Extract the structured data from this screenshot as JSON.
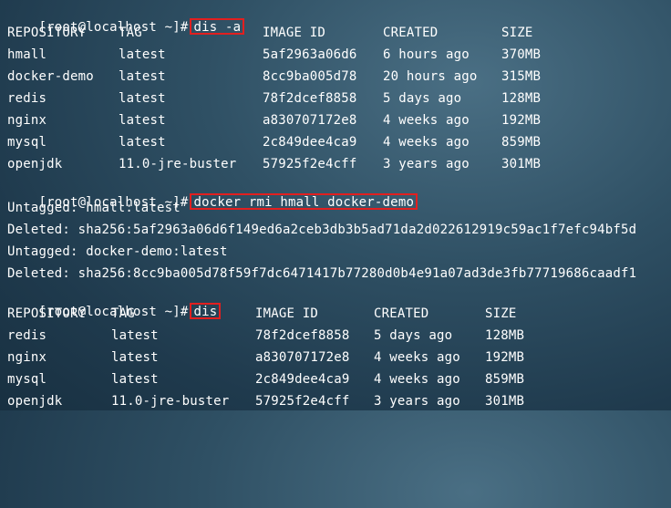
{
  "terminal": {
    "prompt1": "[root@localhost ~]#",
    "cmd1": "dis -a",
    "table1": {
      "headers": [
        "REPOSITORY",
        "TAG",
        "IMAGE ID",
        "CREATED",
        "SIZE"
      ],
      "rows": [
        [
          "hmall",
          "latest",
          "5af2963a06d6",
          "6 hours ago",
          "370MB"
        ],
        [
          "docker-demo",
          "latest",
          "8cc9ba005d78",
          "20 hours ago",
          "315MB"
        ],
        [
          "redis",
          "latest",
          "78f2dcef8858",
          "5 days ago",
          "128MB"
        ],
        [
          "nginx",
          "latest",
          "a830707172e8",
          "4 weeks ago",
          "192MB"
        ],
        [
          "mysql",
          "latest",
          "2c849dee4ca9",
          "4 weeks ago",
          "859MB"
        ],
        [
          "openjdk",
          "11.0-jre-buster",
          "57925f2e4cff",
          "3 years ago",
          "301MB"
        ]
      ]
    },
    "prompt2": "[root@localhost ~]#",
    "cmd2": "docker rmi hmall docker-demo",
    "output": [
      "Untagged: hmall:latest",
      "Deleted: sha256:5af2963a06d6f149ed6a2ceb3db3b5ad71da2d022612919c59ac1f7efc94bf5d",
      "Untagged: docker-demo:latest",
      "Deleted: sha256:8cc9ba005d78f59f7dc6471417b77280d0b4e91a07ad3de3fb77719686caadf1"
    ],
    "prompt3": "[root@localhost ~]#",
    "cmd3": "dis",
    "table2": {
      "headers": [
        "REPOSITORY",
        "TAG",
        "IMAGE ID",
        "CREATED",
        "SIZE"
      ],
      "rows": [
        [
          "redis",
          "latest",
          "78f2dcef8858",
          "5 days ago",
          "128MB"
        ],
        [
          "nginx",
          "latest",
          "a830707172e8",
          "4 weeks ago",
          "192MB"
        ],
        [
          "mysql",
          "latest",
          "2c849dee4ca9",
          "4 weeks ago",
          "859MB"
        ],
        [
          "openjdk",
          "11.0-jre-buster",
          "57925f2e4cff",
          "3 years ago",
          "301MB"
        ]
      ]
    }
  },
  "colors": {
    "highlight_border": "#e21f1f",
    "text": "#ffffff"
  }
}
